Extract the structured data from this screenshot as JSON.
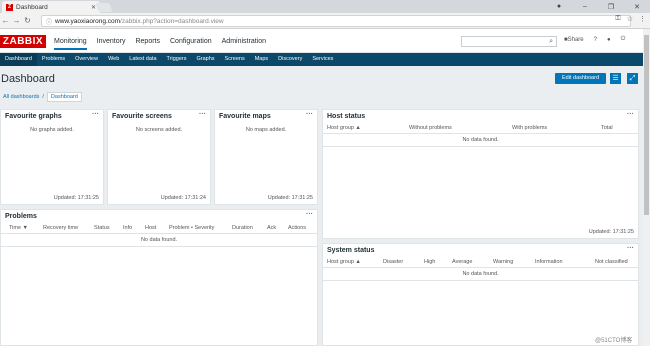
{
  "browser": {
    "tab_title": "Dashboard",
    "favicon": "Z",
    "url_host": "www.yaoxiaorong.com",
    "url_path": "/zabbix.php?action=dashboard.view"
  },
  "header": {
    "logo": "ZABBIX",
    "menu": [
      "Monitoring",
      "Inventory",
      "Reports",
      "Configuration",
      "Administration"
    ],
    "share_label": "Share",
    "help": "?"
  },
  "submenu": [
    "Dashboard",
    "Problems",
    "Overview",
    "Web",
    "Latest data",
    "Triggers",
    "Graphs",
    "Screens",
    "Maps",
    "Discovery",
    "Services"
  ],
  "page": {
    "title": "Dashboard",
    "edit_button": "Edit dashboard",
    "breadcrumb_all": "All dashboards",
    "breadcrumb_sep": "/",
    "breadcrumb_current": "Dashboard"
  },
  "widgets": {
    "fav_graphs": {
      "title": "Favourite graphs",
      "empty": "No graphs added.",
      "updated": "Updated: 17:31:25"
    },
    "fav_screens": {
      "title": "Favourite screens",
      "empty": "No screens added.",
      "updated": "Updated: 17:31:24"
    },
    "fav_maps": {
      "title": "Favourite maps",
      "empty": "No maps added.",
      "updated": "Updated: 17:31:25"
    },
    "host_status": {
      "title": "Host status",
      "columns": [
        "Host group ▲",
        "Without problems",
        "With problems",
        "Total"
      ],
      "empty": "No data found.",
      "updated": "Updated: 17:31:25"
    },
    "problems": {
      "title": "Problems",
      "columns": [
        "Time ▼",
        "Recovery time",
        "Status",
        "Info",
        "Host",
        "Problem • Severity",
        "Duration",
        "Ack",
        "Actions"
      ],
      "empty": "No data found."
    },
    "system_status": {
      "title": "System status",
      "columns": [
        "Host group ▲",
        "Disaster",
        "High",
        "Average",
        "Warning",
        "Information",
        "Not classified"
      ],
      "empty": "No data found."
    }
  },
  "dots": "···",
  "watermark": "@51CTO博客"
}
